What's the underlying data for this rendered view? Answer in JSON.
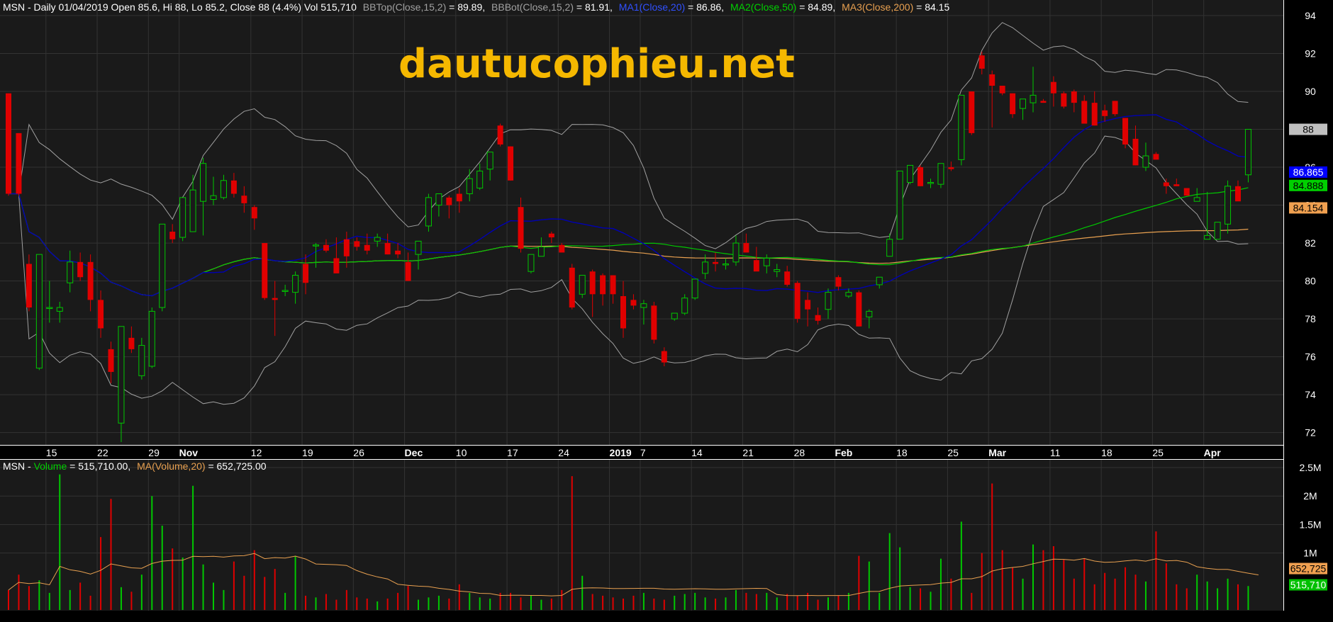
{
  "chart_data": {
    "type": "candlestick",
    "watermark": "dautucophieu.net",
    "price_header": {
      "prefix": "MSN - Daily 01/04/2019 Open 85.6, Hi 88, Lo 85.2, Close 88 (4.4%) Vol 515,710",
      "bbtop_name": "BBTop(Close,15,2)",
      "bbtop_value": " = 89.89,",
      "bbbot_name": "BBBot(Close,15,2)",
      "bbbot_value": " = 81.91,",
      "ma1_name": "MA1(Close,20)",
      "ma1_value": " = 86.86,",
      "ma2_name": "MA2(Close,50)",
      "ma2_value": " = 84.89,",
      "ma3_name": "MA3(Close,200)",
      "ma3_value": " = 84.15"
    },
    "volume_header": {
      "prefix": "MSN - ",
      "vol_name": "Volume",
      "vol_value": " = 515,710.00,",
      "ma_name": "MA(Volume,20)",
      "ma_value": " = 652,725.00"
    },
    "price_axis": {
      "ylim": [
        71.5,
        94.3
      ],
      "ticks": [
        72,
        74,
        76,
        78,
        80,
        82,
        84,
        86,
        88,
        90,
        92,
        94
      ]
    },
    "volume_axis": {
      "ylim": [
        0,
        2.6
      ],
      "ticks": [
        "2.5M",
        "2M",
        "1.5M",
        "1M"
      ],
      "tick_values": [
        2.5,
        2.0,
        1.5,
        1.0
      ]
    },
    "x_labels": [
      {
        "label": "15",
        "i": 4
      },
      {
        "label": "22",
        "i": 9
      },
      {
        "label": "29",
        "i": 14
      },
      {
        "label": "Nov",
        "i": 17,
        "bold": true
      },
      {
        "label": "12",
        "i": 24
      },
      {
        "label": "19",
        "i": 29
      },
      {
        "label": "26",
        "i": 34
      },
      {
        "label": "Dec",
        "i": 39,
        "bold": true
      },
      {
        "label": "10",
        "i": 44
      },
      {
        "label": "17",
        "i": 49
      },
      {
        "label": "24",
        "i": 54
      },
      {
        "label": "2019",
        "i": 59,
        "bold": true
      },
      {
        "label": "7",
        "i": 62
      },
      {
        "label": "14",
        "i": 67
      },
      {
        "label": "21",
        "i": 72
      },
      {
        "label": "28",
        "i": 77
      },
      {
        "label": "Feb",
        "i": 81,
        "bold": true
      },
      {
        "label": "18",
        "i": 87
      },
      {
        "label": "25",
        "i": 92
      },
      {
        "label": "Mar",
        "i": 96,
        "bold": true
      },
      {
        "label": "11",
        "i": 102
      },
      {
        "label": "18",
        "i": 107
      },
      {
        "label": "25",
        "i": 112
      },
      {
        "label": "Apr",
        "i": 117,
        "bold": true
      }
    ],
    "last_values": {
      "close": "88",
      "ma1": "86.865",
      "ma2": "84.888",
      "ma3": "84.154",
      "vol_ma": "652,725",
      "vol": "515,710"
    },
    "ohlc": [
      [
        89.9,
        89.9,
        84.5,
        84.6
      ],
      [
        87.8,
        87.8,
        84.5,
        84.6
      ],
      [
        80.9,
        81.4,
        78.4,
        78.6
      ],
      [
        75.4,
        81.4,
        75.3,
        81.4
      ],
      [
        78.6,
        80.0,
        77.8,
        78.6
      ],
      [
        78.4,
        78.9,
        77.8,
        78.6
      ],
      [
        79.9,
        81.6,
        79.4,
        81.0
      ],
      [
        81.0,
        81.5,
        80.0,
        80.2
      ],
      [
        81.0,
        81.4,
        78.4,
        79.0
      ],
      [
        79.0,
        79.5,
        77.0,
        77.5
      ],
      [
        76.4,
        76.8,
        74.6,
        75.2
      ],
      [
        72.5,
        77.6,
        71.5,
        77.6
      ],
      [
        77.0,
        77.6,
        76.2,
        76.4
      ],
      [
        75.0,
        77.0,
        74.8,
        76.6
      ],
      [
        75.5,
        78.6,
        75.4,
        78.4
      ],
      [
        78.6,
        83.0,
        78.4,
        83.0
      ],
      [
        82.6,
        83.0,
        82.0,
        82.2
      ],
      [
        82.3,
        84.4,
        82.1,
        84.4
      ],
      [
        82.6,
        85.6,
        82.6,
        84.8
      ],
      [
        84.2,
        86.5,
        82.4,
        86.2
      ],
      [
        84.3,
        85.5,
        84.0,
        84.5
      ],
      [
        84.4,
        85.6,
        84.3,
        85.3
      ],
      [
        85.3,
        85.7,
        84.4,
        84.6
      ],
      [
        84.5,
        85.0,
        83.6,
        84.1
      ],
      [
        83.9,
        84.0,
        82.7,
        83.3
      ],
      [
        82.0,
        82.0,
        79.0,
        79.1
      ],
      [
        79.1,
        80.0,
        77.1,
        79.0
      ],
      [
        79.5,
        79.8,
        79.2,
        79.5
      ],
      [
        79.4,
        80.5,
        78.8,
        80.3
      ],
      [
        80.9,
        81.4,
        79.3,
        79.9
      ],
      [
        81.9,
        82.0,
        80.7,
        81.9
      ],
      [
        81.9,
        82.2,
        81.5,
        81.6
      ],
      [
        81.2,
        82.3,
        80.5,
        80.4
      ],
      [
        82.2,
        82.6,
        80.7,
        81.3
      ],
      [
        82.1,
        82.3,
        81.6,
        81.8
      ],
      [
        81.9,
        82.5,
        81.4,
        81.6
      ],
      [
        82.1,
        82.5,
        81.8,
        82.3
      ],
      [
        82.0,
        82.5,
        81.4,
        81.4
      ],
      [
        81.6,
        82.0,
        81.2,
        81.4
      ],
      [
        81.0,
        81.5,
        80.0,
        80.0
      ],
      [
        81.4,
        81.5,
        80.6,
        82.1
      ],
      [
        82.9,
        84.6,
        82.6,
        84.4
      ],
      [
        84.0,
        84.6,
        83.4,
        84.6
      ],
      [
        84.4,
        84.5,
        83.3,
        84.0
      ],
      [
        84.6,
        84.9,
        83.6,
        84.2
      ],
      [
        84.6,
        85.9,
        84.2,
        85.4
      ],
      [
        84.9,
        86.2,
        84.8,
        85.8
      ],
      [
        85.9,
        86.7,
        85.3,
        86.8
      ],
      [
        88.2,
        88.3,
        87.1,
        87.2
      ],
      [
        87.1,
        87.1,
        85.3,
        85.3
      ],
      [
        83.9,
        84.4,
        81.5,
        81.7
      ],
      [
        80.5,
        81.4,
        80.4,
        81.4
      ],
      [
        81.3,
        82.3,
        81.4,
        81.8
      ],
      [
        82.5,
        82.6,
        82.0,
        82.3
      ],
      [
        81.9,
        82.0,
        81.8,
        81.5
      ],
      [
        80.7,
        80.9,
        78.5,
        78.6
      ],
      [
        79.3,
        80.2,
        79.1,
        80.3
      ],
      [
        80.5,
        80.6,
        78.1,
        79.3
      ],
      [
        80.3,
        80.4,
        78.7,
        79.3
      ],
      [
        80.3,
        80.3,
        78.8,
        79.3
      ],
      [
        79.2,
        80.0,
        77.0,
        77.5
      ],
      [
        79.0,
        79.3,
        78.5,
        78.7
      ],
      [
        78.6,
        79.0,
        77.7,
        78.8
      ],
      [
        78.7,
        78.9,
        76.7,
        76.9
      ],
      [
        76.3,
        76.5,
        75.5,
        75.7
      ],
      [
        78.0,
        78.2,
        77.9,
        78.3
      ],
      [
        78.3,
        79.3,
        78.2,
        79.1
      ],
      [
        79.1,
        80.1,
        79.0,
        80.1
      ],
      [
        80.4,
        81.4,
        80.1,
        81.0
      ],
      [
        81.0,
        81.5,
        80.5,
        80.9
      ],
      [
        80.9,
        81.2,
        80.6,
        80.9
      ],
      [
        81.0,
        82.4,
        80.8,
        82.0
      ],
      [
        82.0,
        82.5,
        81.6,
        81.5
      ],
      [
        81.1,
        81.8,
        80.7,
        80.5
      ],
      [
        80.8,
        81.4,
        80.4,
        81.2
      ],
      [
        80.5,
        80.9,
        80.2,
        80.6
      ],
      [
        80.5,
        80.8,
        79.7,
        79.8
      ],
      [
        79.9,
        80.0,
        77.8,
        78.0
      ],
      [
        79.0,
        79.4,
        77.6,
        78.5
      ],
      [
        78.2,
        78.6,
        77.7,
        77.9
      ],
      [
        78.5,
        79.6,
        78.0,
        79.4
      ],
      [
        80.2,
        80.3,
        79.5,
        79.7
      ],
      [
        79.2,
        79.6,
        79.1,
        79.4
      ],
      [
        79.4,
        79.5,
        77.6,
        77.6
      ],
      [
        78.1,
        78.5,
        77.5,
        78.4
      ],
      [
        79.8,
        80.2,
        79.6,
        80.2
      ],
      [
        81.3,
        82.5,
        81.3,
        82.2
      ],
      [
        82.2,
        84.1,
        82.2,
        85.8
      ],
      [
        85.2,
        86.1,
        85.1,
        86.1
      ],
      [
        86.0,
        86.1,
        85.0,
        85.0
      ],
      [
        85.2,
        85.4,
        84.9,
        85.2
      ],
      [
        85.1,
        86.0,
        84.9,
        86.2
      ],
      [
        86.0,
        86.3,
        85.8,
        85.9
      ],
      [
        86.4,
        89.2,
        86.1,
        89.8
      ],
      [
        90.0,
        90.0,
        87.7,
        87.8
      ],
      [
        91.9,
        92.1,
        90.9,
        91.2
      ],
      [
        90.9,
        91.1,
        88.1,
        90.3
      ],
      [
        90.3,
        90.3,
        89.8,
        89.9
      ],
      [
        89.9,
        89.9,
        88.6,
        88.8
      ],
      [
        89.1,
        89.6,
        88.5,
        89.6
      ],
      [
        89.4,
        91.3,
        88.9,
        89.8
      ],
      [
        89.5,
        89.6,
        89.4,
        89.4
      ],
      [
        90.5,
        90.8,
        89.2,
        89.9
      ],
      [
        89.9,
        90.0,
        89.1,
        89.2
      ],
      [
        90.0,
        90.1,
        88.9,
        89.4
      ],
      [
        89.5,
        89.8,
        89.3,
        88.3
      ],
      [
        89.4,
        90.0,
        88.2,
        88.2
      ],
      [
        89.0,
        89.3,
        88.4,
        88.7
      ],
      [
        89.5,
        89.5,
        88.7,
        88.8
      ],
      [
        88.6,
        88.6,
        87.0,
        87.2
      ],
      [
        87.5,
        88.2,
        86.1,
        86.1
      ],
      [
        86.0,
        87.3,
        85.8,
        86.6
      ],
      [
        86.7,
        86.8,
        86.4,
        86.4
      ],
      [
        85.2,
        85.4,
        84.6,
        85.0
      ],
      [
        85.1,
        85.4,
        85.0,
        85.0
      ],
      [
        84.9,
        84.9,
        84.5,
        84.5
      ],
      [
        84.2,
        84.9,
        84.3,
        84.4
      ],
      [
        82.2,
        84.7,
        82.2,
        82.4
      ],
      [
        82.2,
        83.1,
        82.2,
        83.1
      ],
      [
        83.0,
        85.3,
        82.5,
        85.0
      ],
      [
        85.0,
        85.3,
        84.3,
        84.2
      ],
      [
        85.6,
        86.8,
        85.2,
        88.0
      ]
    ],
    "volume": [
      0.35,
      0.62,
      0.42,
      0.52,
      0.3,
      2.38,
      0.35,
      0.48,
      0.25,
      1.28,
      1.95,
      0.4,
      0.32,
      0.62,
      2.0,
      1.48,
      1.08,
      0.92,
      2.18,
      0.8,
      0.48,
      0.35,
      0.85,
      0.6,
      1.05,
      0.58,
      0.72,
      0.3,
      0.95,
      0.25,
      0.22,
      0.28,
      0.18,
      0.35,
      0.22,
      0.2,
      0.15,
      0.2,
      0.3,
      0.42,
      0.18,
      0.22,
      0.25,
      0.2,
      0.45,
      0.3,
      0.22,
      0.2,
      0.3,
      0.3,
      0.22,
      0.25,
      0.18,
      0.2,
      0.35,
      2.35,
      0.6,
      0.28,
      0.25,
      0.22,
      0.2,
      0.25,
      0.3,
      0.2,
      0.18,
      0.25,
      0.28,
      0.3,
      0.22,
      0.2,
      0.22,
      0.35,
      0.3,
      0.28,
      0.3,
      0.22,
      0.28,
      0.25,
      0.3,
      0.18,
      0.22,
      0.25,
      0.3,
      0.95,
      0.85,
      0.3,
      1.35,
      1.1,
      0.4,
      0.38,
      0.32,
      0.9,
      0.55,
      1.55,
      0.3,
      1.0,
      2.22,
      1.05,
      0.75,
      0.55,
      1.15,
      1.05,
      1.12,
      0.88,
      0.55,
      0.9,
      0.45,
      0.65,
      0.55,
      0.75,
      0.62,
      0.5,
      1.38,
      0.82,
      0.45,
      0.38,
      0.62,
      0.5,
      0.38,
      0.55,
      0.45,
      0.42,
      0.52
    ],
    "series_style": {
      "up": "#00c800",
      "down": "#e00000",
      "bb": "#a0a0a0",
      "ma1": "#0000b4",
      "ma2": "#00c800",
      "ma3": "#e8a050",
      "vol_ma": "#e8a050"
    }
  }
}
